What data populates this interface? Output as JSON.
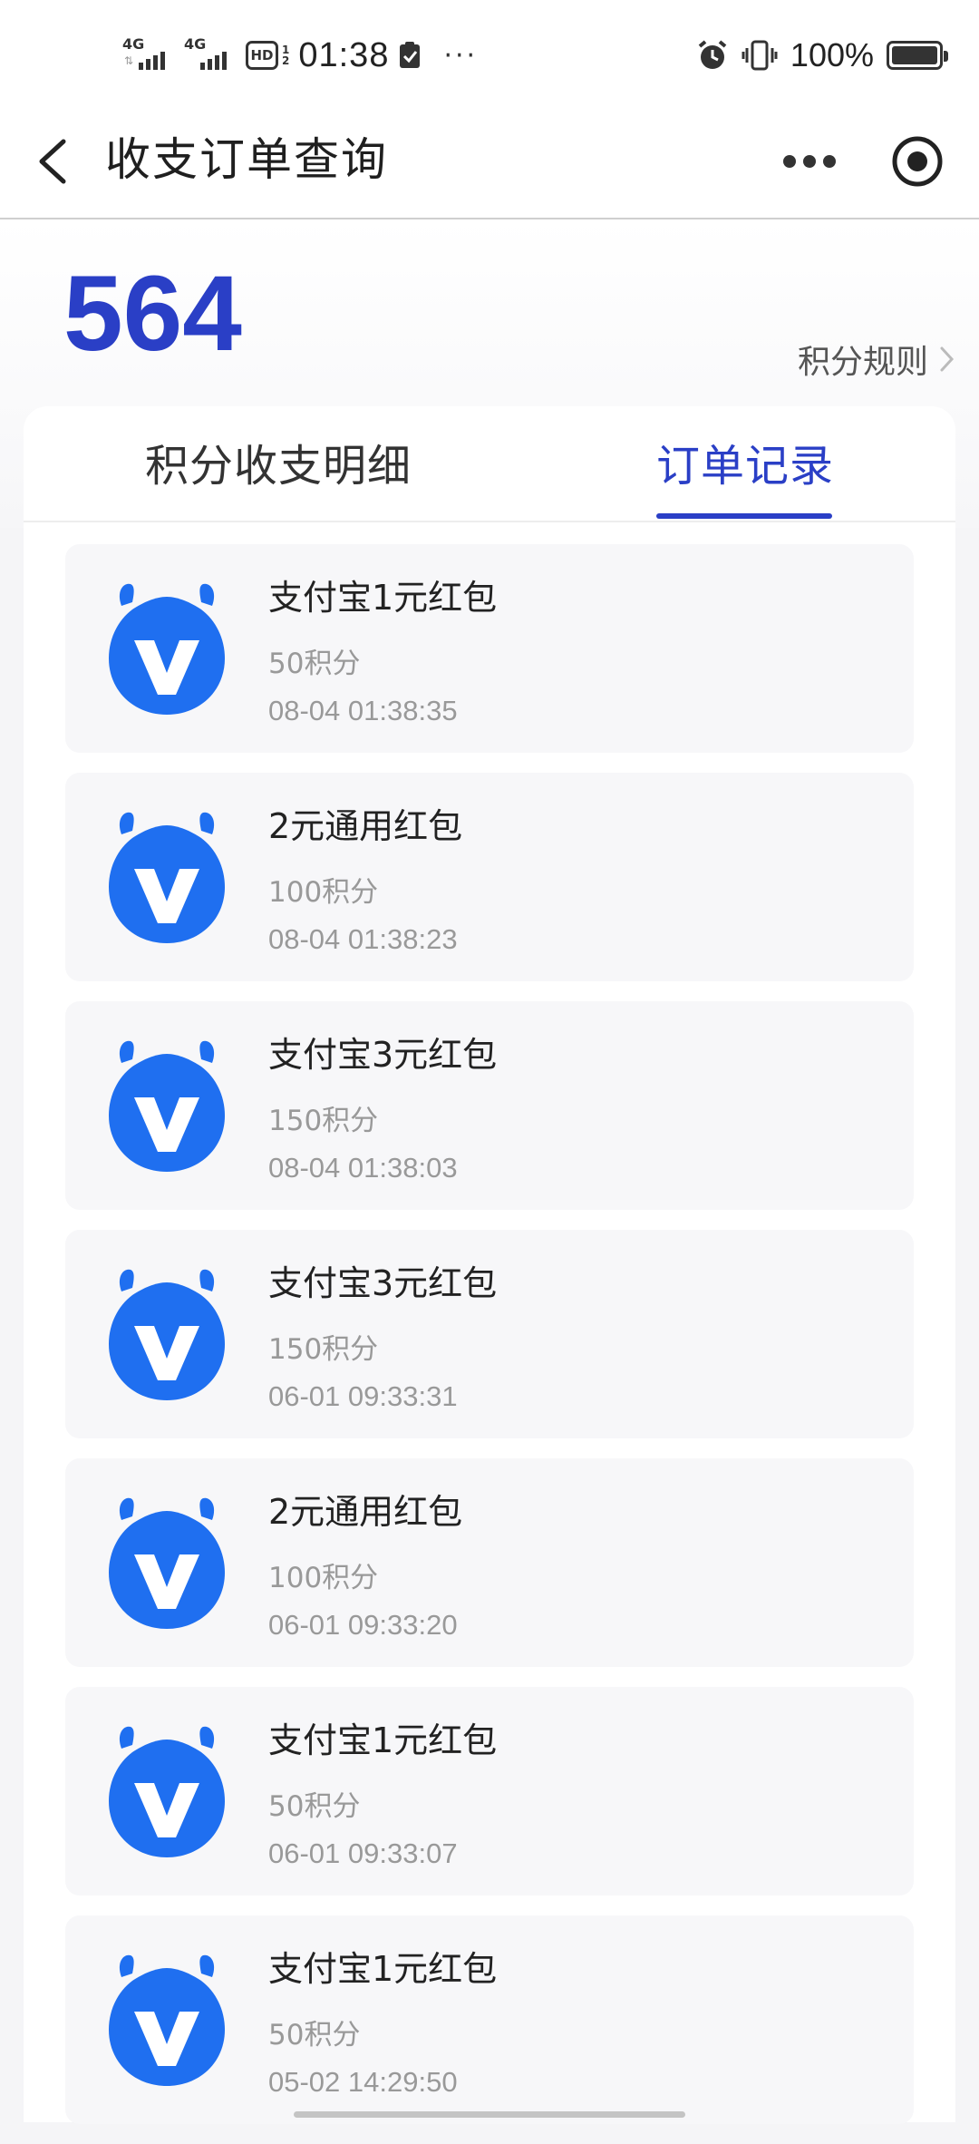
{
  "status_bar": {
    "network1": "4G",
    "network2": "4G",
    "hd": "HD",
    "hd_sub1": "1",
    "hd_sub2": "2",
    "time": "01:38",
    "more": "···",
    "battery": "100%",
    "battery_level": 1.0
  },
  "nav": {
    "title": "收支订单查询",
    "back_icon": "chevron-left-icon",
    "more_icon": "more-dots-icon",
    "capsule_icon": "target-circle-icon"
  },
  "points": {
    "value": "564",
    "rule_label": "积分规则"
  },
  "tabs": [
    {
      "label": "积分收支明细",
      "active": false
    },
    {
      "label": "订单记录",
      "active": true
    }
  ],
  "orders": [
    {
      "title": "支付宝1元红包",
      "points": "50积分",
      "time": "08-04 01:38:35"
    },
    {
      "title": "2元通用红包",
      "points": "100积分",
      "time": "08-04 01:38:23"
    },
    {
      "title": "支付宝3元红包",
      "points": "150积分",
      "time": "08-04 01:38:03"
    },
    {
      "title": "支付宝3元红包",
      "points": "150积分",
      "time": "06-01 09:33:31"
    },
    {
      "title": "2元通用红包",
      "points": "100积分",
      "time": "06-01 09:33:20"
    },
    {
      "title": "支付宝1元红包",
      "points": "50积分",
      "time": "06-01 09:33:07"
    },
    {
      "title": "支付宝1元红包",
      "points": "50积分",
      "time": "05-02 14:29:50"
    }
  ],
  "colors": {
    "accent": "#2a3fc6",
    "logo_blue": "#1f6ff0",
    "item_bg": "#f7f7f9",
    "muted_text": "#999999"
  }
}
